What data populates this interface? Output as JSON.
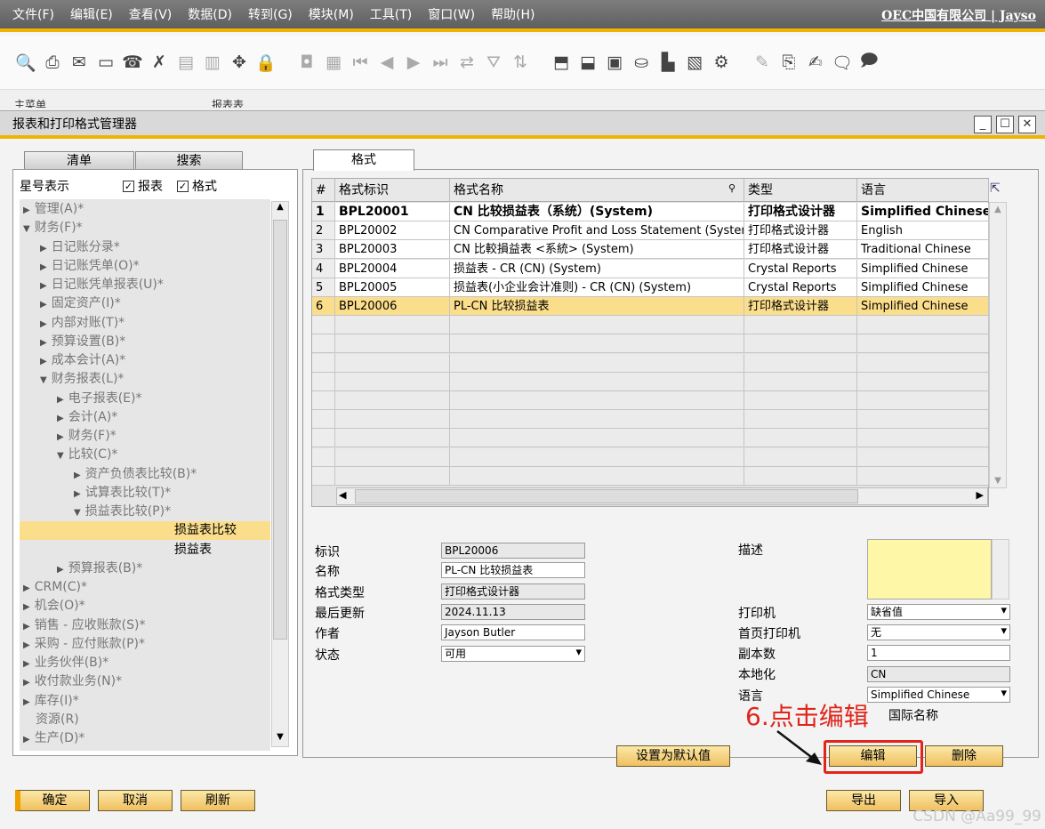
{
  "menubar": {
    "items": [
      "文件(F)",
      "编辑(E)",
      "查看(V)",
      "数据(D)",
      "转到(G)",
      "模块(M)",
      "工具(T)",
      "窗口(W)",
      "帮助(H)"
    ],
    "company": "OEC中国有限公司 | Jayso"
  },
  "bg_tabs": {
    "left": "主菜单",
    "right": "报表表"
  },
  "window": {
    "title": "报表和打印格式管理器"
  },
  "left": {
    "tabs": [
      "清单",
      "搜索"
    ],
    "star_label": "星号表示",
    "check_report": "报表",
    "check_format": "格式",
    "tree": [
      {
        "label": "管理(A)*",
        "lvl": 0,
        "exp": "r"
      },
      {
        "label": "财务(F)*",
        "lvl": 0,
        "exp": "d"
      },
      {
        "label": "日记账分录*",
        "lvl": 1,
        "exp": "r"
      },
      {
        "label": "日记账凭单(O)*",
        "lvl": 1,
        "exp": "r"
      },
      {
        "label": "日记账凭单报表(U)*",
        "lvl": 1,
        "exp": "r"
      },
      {
        "label": "固定资产(I)*",
        "lvl": 1,
        "exp": "r"
      },
      {
        "label": "内部对账(T)*",
        "lvl": 1,
        "exp": "r"
      },
      {
        "label": "预算设置(B)*",
        "lvl": 1,
        "exp": "r"
      },
      {
        "label": "成本会计(A)*",
        "lvl": 1,
        "exp": "r"
      },
      {
        "label": "财务报表(L)*",
        "lvl": 1,
        "exp": "d"
      },
      {
        "label": "电子报表(E)*",
        "lvl": 2,
        "exp": "r"
      },
      {
        "label": "会计(A)*",
        "lvl": 2,
        "exp": "r"
      },
      {
        "label": "财务(F)*",
        "lvl": 2,
        "exp": "r"
      },
      {
        "label": "比较(C)*",
        "lvl": 2,
        "exp": "d"
      },
      {
        "label": "资产负债表比较(B)*",
        "lvl": 3,
        "exp": "r"
      },
      {
        "label": "试算表比较(T)*",
        "lvl": 3,
        "exp": "r"
      },
      {
        "label": "损益表比较(P)*",
        "lvl": 3,
        "exp": "d"
      },
      {
        "label": "损益表比较",
        "lvl": 4,
        "exp": "",
        "sel": true
      },
      {
        "label": "损益表",
        "lvl": 4,
        "exp": "",
        "dark": true
      },
      {
        "label": "预算报表(B)*",
        "lvl": 2,
        "exp": "r"
      },
      {
        "label": "CRM(C)*",
        "lvl": 0,
        "exp": "r"
      },
      {
        "label": "机会(O)*",
        "lvl": 0,
        "exp": "r"
      },
      {
        "label": "销售 - 应收账款(S)*",
        "lvl": 0,
        "exp": "r"
      },
      {
        "label": "采购 - 应付账款(P)*",
        "lvl": 0,
        "exp": "r"
      },
      {
        "label": "业务伙伴(B)*",
        "lvl": 0,
        "exp": "r"
      },
      {
        "label": "收付款业务(N)*",
        "lvl": 0,
        "exp": "r"
      },
      {
        "label": "库存(I)*",
        "lvl": 0,
        "exp": "r"
      },
      {
        "label": "资源(R)",
        "lvl": 0,
        "exp": ""
      },
      {
        "label": "生产(D)*",
        "lvl": 0,
        "exp": "r"
      }
    ]
  },
  "format_tab": "格式",
  "grid": {
    "headers": [
      "#",
      "格式标识",
      "格式名称",
      "类型",
      "语言"
    ],
    "rows": [
      [
        "1",
        "BPL20001",
        "CN 比较损益表（系统）(System)",
        "打印格式设计器",
        "Simplified Chinese"
      ],
      [
        "2",
        "BPL20002",
        "CN Comparative Profit and Loss Statement (System) (S",
        "打印格式设计器",
        "English"
      ],
      [
        "3",
        "BPL20003",
        "CN 比較損益表 <系統> (System)",
        "打印格式设计器",
        "Traditional Chinese"
      ],
      [
        "4",
        "BPL20004",
        "损益表 - CR (CN) (System)",
        "Crystal Reports",
        "Simplified Chinese"
      ],
      [
        "5",
        "BPL20005",
        "损益表(小企业会计准则) - CR (CN) (System)",
        "Crystal Reports",
        "Simplified Chinese"
      ],
      [
        "6",
        "BPL20006",
        "PL-CN 比较损益表",
        "打印格式设计器",
        "Simplified Chinese"
      ]
    ]
  },
  "form": {
    "id_label": "标识",
    "id_value": "BPL20006",
    "name_label": "名称",
    "name_value": "PL-CN 比较损益表",
    "type_label": "格式类型",
    "type_value": "打印格式设计器",
    "updated_label": "最后更新",
    "updated_value": "2024.11.13",
    "author_label": "作者",
    "author_value": "Jayson Butler",
    "status_label": "状态",
    "status_value": "可用",
    "desc_label": "描述",
    "printer_label": "打印机",
    "printer_value": "缺省值",
    "first_printer_label": "首页打印机",
    "first_printer_value": "无",
    "copies_label": "副本数",
    "copies_value": "1",
    "local_label": "本地化",
    "local_value": "CN",
    "lang_label": "语言",
    "lang_value": "Simplified Chinese",
    "intl_name": "国际名称"
  },
  "buttons": {
    "set_default": "设置为默认值",
    "edit": "编辑",
    "delete": "删除",
    "ok": "确定",
    "cancel": "取消",
    "refresh": "刷新",
    "export": "导出",
    "import": "导入"
  },
  "annotation": "6.点击编辑",
  "watermark": "CSDN @Aa99_99",
  "colors": {
    "accent": "#f0b400",
    "highlight": "#fbde8c",
    "annotation": "#e0251b"
  }
}
